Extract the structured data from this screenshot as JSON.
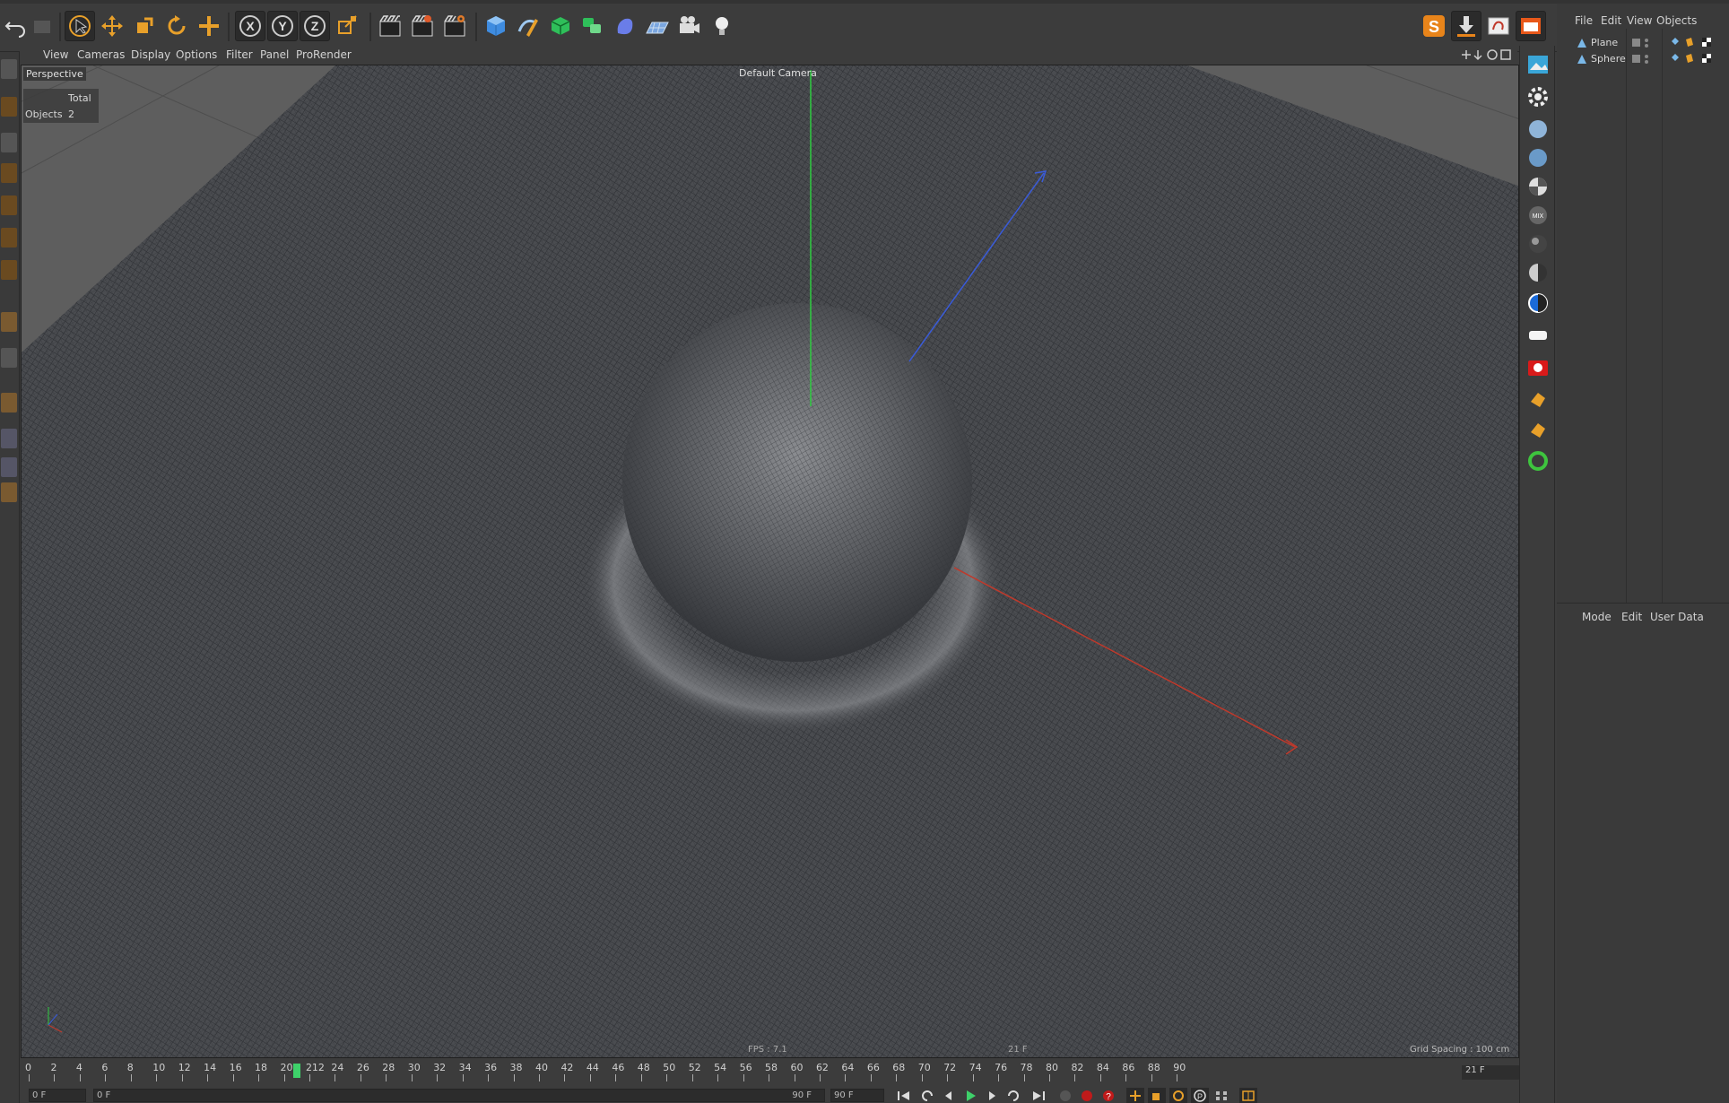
{
  "toolbar": {
    "icons": [
      "undo-icon",
      "redo-icon",
      "select-icon",
      "move-icon",
      "scale-icon",
      "rotate-icon",
      "live-select-icon",
      "x-axis-icon",
      "y-axis-icon",
      "z-axis-icon",
      "coordinate-system-icon",
      "render-view-icon",
      "render-picture-viewer-icon",
      "edit-render-settings-icon",
      "cube-icon",
      "pen-icon",
      "subdivision-icon",
      "array-icon",
      "deformer-icon",
      "floor-icon",
      "camera-icon",
      "light-icon"
    ],
    "x_label": "X",
    "y_label": "Y",
    "z_label": "Z"
  },
  "viewport_menu": [
    "View",
    "Cameras",
    "Display",
    "Options",
    "Filter",
    "Panel",
    "ProRender"
  ],
  "viewport": {
    "view_name": "Perspective",
    "camera": "Default Camera",
    "hud_total": "Total",
    "hud_objects_label": "Objects",
    "hud_objects_value": "2",
    "fps": "FPS : 7.1",
    "frame": "21 F",
    "grid_spacing": "Grid Spacing : 100 cm"
  },
  "object_manager": {
    "menu": [
      "File",
      "Edit",
      "View",
      "Objects"
    ],
    "objects": [
      {
        "name": "Plane"
      },
      {
        "name": "Sphere"
      }
    ]
  },
  "attributes": {
    "menu": [
      "Mode",
      "Edit",
      "User Data"
    ]
  },
  "timeline": {
    "ticks": [
      "0",
      "2",
      "4",
      "6",
      "8",
      "10",
      "12",
      "14",
      "16",
      "18",
      "20",
      "212",
      "24",
      "26",
      "28",
      "30",
      "32",
      "34",
      "36",
      "38",
      "40",
      "42",
      "44",
      "46",
      "48",
      "50",
      "52",
      "54",
      "56",
      "58",
      "60",
      "62",
      "64",
      "66",
      "68",
      "70",
      "72",
      "74",
      "76",
      "78",
      "80",
      "82",
      "84",
      "86",
      "88",
      "90"
    ],
    "current_frame_value": 21,
    "current_frame": "21 F",
    "start_field": "0 F",
    "range_start": "0 F",
    "range_end": "90 F",
    "end_field": "90 F"
  },
  "colors": {
    "accent_orange": "#e8a02a",
    "x_axis_red": "#c0392b",
    "y_axis_green": "#2ecc40",
    "z_axis_blue": "#3a5bd9",
    "playhead_green": "#3ed16a"
  }
}
